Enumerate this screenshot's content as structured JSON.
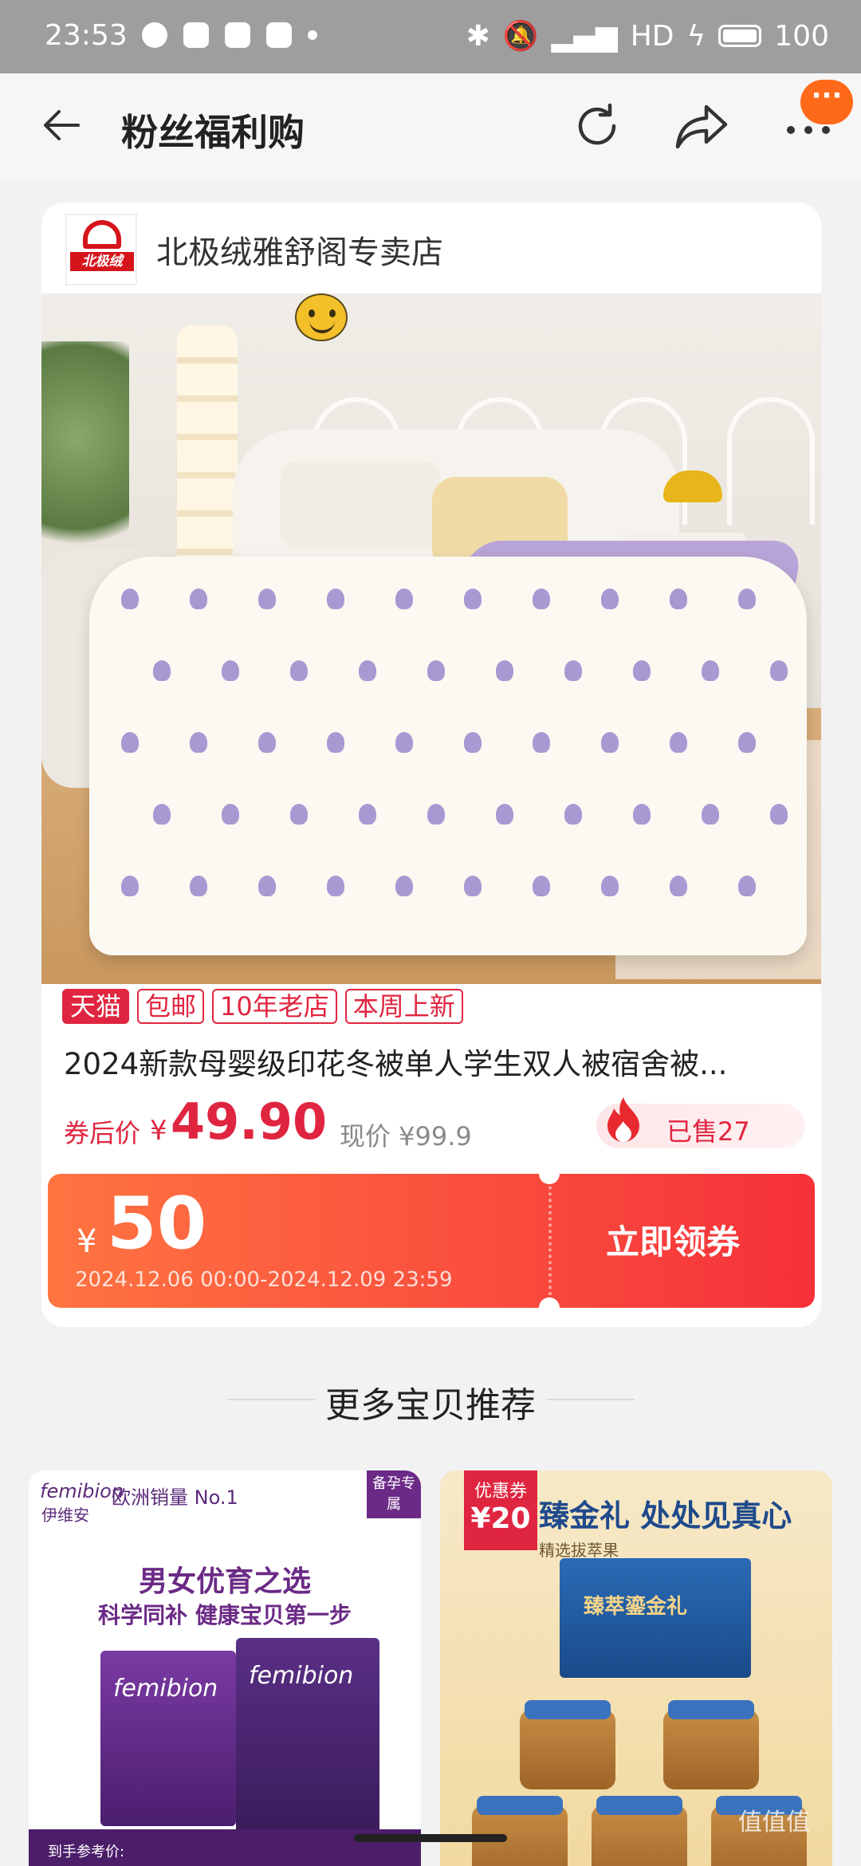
{
  "status_bar": {
    "time": "23:53",
    "battery": "100",
    "network": "HD"
  },
  "nav": {
    "title": "粉丝福利购",
    "badge": "···"
  },
  "store": {
    "name": "北极绒雅舒阁专卖店",
    "logo_text": "北极绒"
  },
  "product": {
    "tags": [
      "天猫",
      "包邮",
      "10年老店",
      "本周上新"
    ],
    "title": "2024新款母婴级印花冬被单人学生双人被宿舍被...",
    "price_label": "券后价",
    "currency": "¥",
    "price": "49.90",
    "original_price": "现价 ¥99.9",
    "sold": "已售27"
  },
  "coupon": {
    "currency": "¥",
    "amount": "50",
    "validity": "2024.12.06 00:00-2024.12.09 23:59",
    "claim_label": "立即领券"
  },
  "section": {
    "title": "更多宝贝推荐"
  },
  "recommendations": [
    {
      "brand": "femibion",
      "brand_cn": "伊维安",
      "ad": "欧洲销量 No.1",
      "corner": "备孕专属",
      "headline": "男女优育之选",
      "sub": "科学同补 健康宝贝第一步",
      "box1": "femibion",
      "box2": "femibion",
      "footer": "到手参考价:"
    },
    {
      "ribbon_label": "优惠券",
      "ribbon_value": "¥20",
      "banner": "臻金礼 处处见真心",
      "sub": "精选拔萃果",
      "box_text": "臻萃鎏金礼"
    }
  ],
  "watermark": "值值值",
  "colors": {
    "accent": "#e02540",
    "coupon_start": "#ff7441",
    "coupon_end": "#f5313a",
    "badge": "#ff6a1a"
  }
}
